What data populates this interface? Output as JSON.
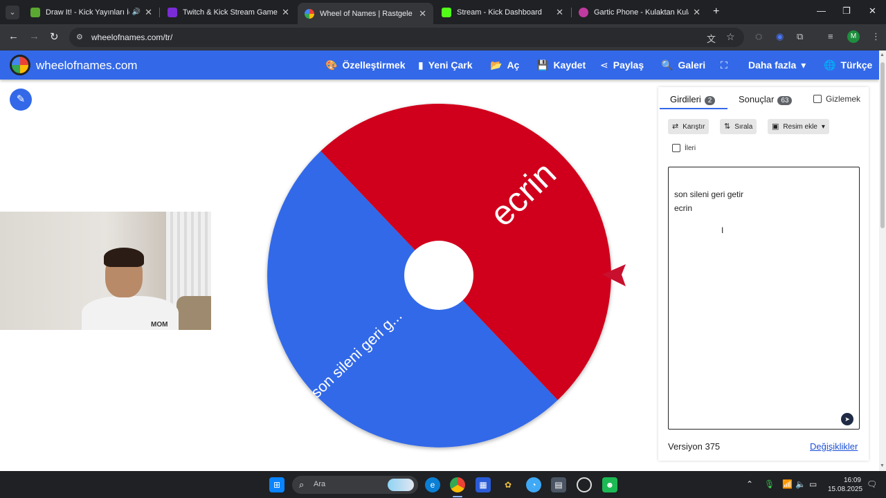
{
  "browser": {
    "tabs": [
      {
        "title": "Draw It! - Kick Yayınları İçin",
        "favicon_color": "#5aa832",
        "audio": true
      },
      {
        "title": "Twitch & Kick Stream Games",
        "favicon_color": "#7b2cd6"
      },
      {
        "title": "Wheel of Names | Rastgele ad s",
        "favicon_color": "#ea4335",
        "active": true
      },
      {
        "title": "Stream - Kick Dashboard",
        "favicon_color": "#53fc18"
      },
      {
        "title": "Gartic Phone - Kulaktan Kulağa",
        "favicon_color": "#c03aa0"
      }
    ],
    "url": "wheelofnames.com/tr/",
    "profile_initial": "M"
  },
  "site": {
    "brand": "wheelofnames.com",
    "nav": [
      {
        "icon": "palette-icon",
        "label": "Özelleştirmek"
      },
      {
        "icon": "file-icon",
        "label": "Yeni Çark"
      },
      {
        "icon": "folder-open-icon",
        "label": "Aç"
      },
      {
        "icon": "save-icon",
        "label": "Kaydet"
      },
      {
        "icon": "share-icon",
        "label": "Paylaş"
      },
      {
        "icon": "search-icon",
        "label": "Galeri"
      },
      {
        "icon": "fullscreen-icon",
        "label": ""
      },
      {
        "icon": "chevron-down-icon",
        "label": "Daha fazla"
      },
      {
        "icon": "globe-icon",
        "label": "Türkçe"
      }
    ]
  },
  "wheel": {
    "segments": [
      {
        "label": "ecrin",
        "color": "#d0021b"
      },
      {
        "label": "son sileni geri g...",
        "color": "#3369e8"
      }
    ],
    "center_color": "#ffffff",
    "pointer_color": "#c8102e"
  },
  "webcam": {
    "shirt_text": "MOM"
  },
  "panel": {
    "tab_entries": "Girdileri",
    "entries_count": "2",
    "tab_results": "Sonuçlar",
    "results_count": "63",
    "hide_label": "Gizlemek",
    "shuffle_label": "Karıştır",
    "sort_label": "Sırala",
    "add_image_label": "Resim ekle",
    "advanced_label": "İleri",
    "entries": [
      "son sileni geri getir",
      "ecrin"
    ],
    "version": "Versiyon 375",
    "changes_link": "Değişiklikler"
  },
  "taskbar": {
    "search_placeholder": "Ara",
    "time": "16:09",
    "date": "15.08.2025"
  }
}
